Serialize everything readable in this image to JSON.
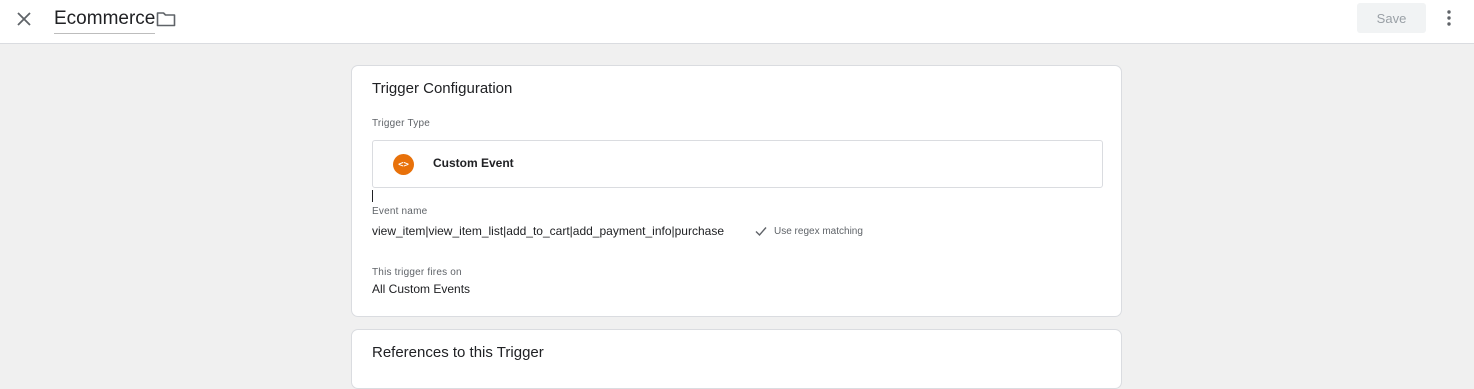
{
  "header": {
    "close_icon": "close-icon",
    "title": "Ecommerce",
    "folder_icon": "folder-icon",
    "save_label": "Save",
    "more_icon": "more-vert-icon"
  },
  "trigger_config": {
    "title": "Trigger Configuration",
    "trigger_type_label": "Trigger Type",
    "trigger_type_icon": "custom-event-code-icon",
    "trigger_type_icon_color": "#e8710a",
    "trigger_type_value": "Custom Event",
    "event_name_label": "Event name",
    "event_name_value": "view_item|view_item_list|add_to_cart|add_payment_info|purchase",
    "regex_label": "Use regex matching",
    "regex_checked": true,
    "fires_on_label": "This trigger fires on",
    "fires_on_value": "All Custom Events"
  },
  "references": {
    "title": "References to this Trigger"
  }
}
